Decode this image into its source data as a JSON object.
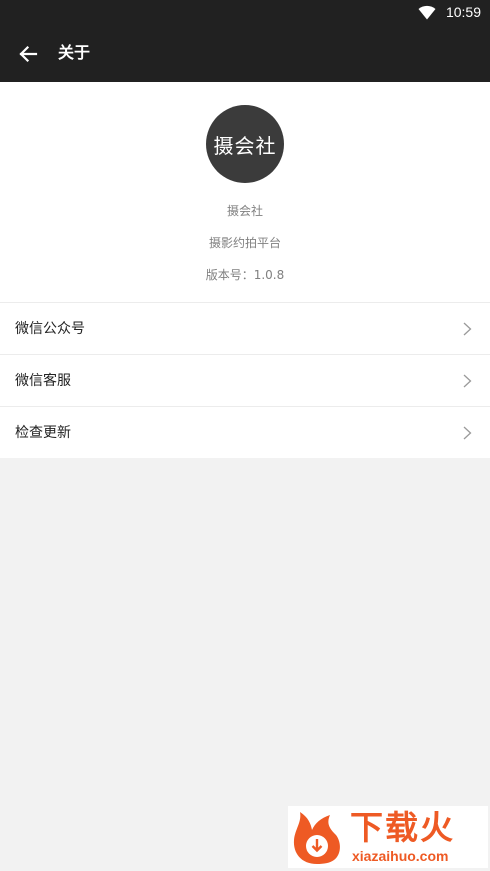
{
  "status_bar": {
    "time": "10:59",
    "icons": [
      "wifi-icon"
    ]
  },
  "app_bar": {
    "title": "关于",
    "back_icon": "arrow-left-icon"
  },
  "about": {
    "logo_text": "摄会社",
    "app_name": "摄会社",
    "slogan": "摄影约拍平台",
    "version": "版本号：1.0.8"
  },
  "menu": {
    "items": [
      {
        "label": "微信公众号",
        "icon": "chevron-right-icon"
      },
      {
        "label": "微信客服",
        "icon": "chevron-right-icon"
      },
      {
        "label": "检查更新",
        "icon": "chevron-right-icon"
      }
    ]
  },
  "watermark": {
    "brand": "下载火",
    "domain": "xiazaihuo.com"
  },
  "colors": {
    "app_bar": "#212121",
    "background": "#f2f2f2",
    "logo": "#3b3b3b",
    "secondary_text": "#808080",
    "watermark_accent": "#ee5a24"
  }
}
